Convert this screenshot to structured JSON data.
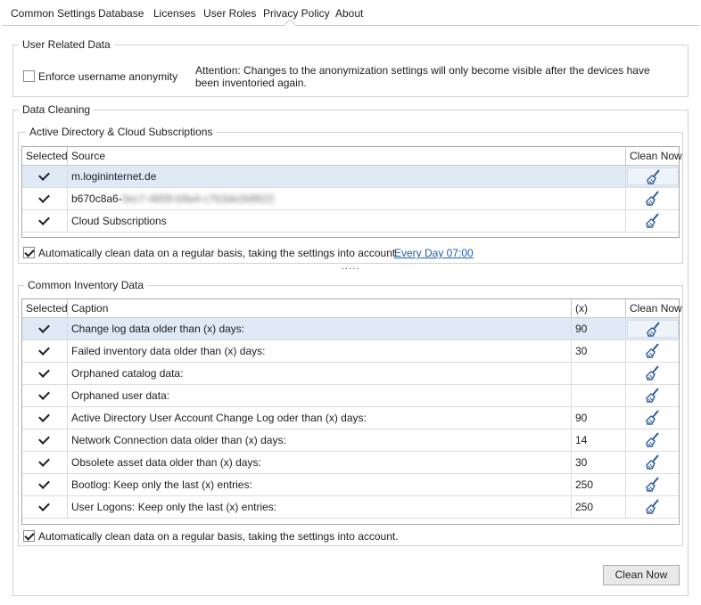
{
  "tabs": [
    {
      "label": "Common Settings"
    },
    {
      "label": "Database"
    },
    {
      "label": "Licenses"
    },
    {
      "label": "User Roles"
    },
    {
      "label": "Privacy Policy",
      "active": true
    },
    {
      "label": "About"
    }
  ],
  "user_related": {
    "title": "User Related Data",
    "enforce_label": "Enforce username anonymity",
    "enforce_checked": false,
    "attention": "Attention: Changes to the anonymization settings will only become visible after the devices have been inventoried again."
  },
  "data_cleaning": {
    "title": "Data Cleaning",
    "ad": {
      "title": "Active Directory & Cloud Subscriptions",
      "columns": [
        "Selected",
        "Source",
        "Clean Now"
      ],
      "rows": [
        {
          "selected": true,
          "source": "m.logininternet.de",
          "blurred_suffix": ""
        },
        {
          "selected": true,
          "source": "b670c8a6-",
          "blurred_suffix": "0ec7-4659-b9a4-c7b3de2b8622"
        },
        {
          "selected": true,
          "source": "Cloud Subscriptions",
          "blurred_suffix": ""
        }
      ],
      "auto_clean_label": "Automatically clean data on a regular basis, taking the settings into account.",
      "auto_clean_checked": true,
      "schedule_link": "Every Day  07:00"
    },
    "splitter": ".....",
    "inventory": {
      "title": "Common Inventory Data",
      "columns": [
        "Selected",
        "Caption",
        "(x)",
        "Clean Now"
      ],
      "rows": [
        {
          "selected": true,
          "caption": "Change log data older than (x) days:",
          "x": "90"
        },
        {
          "selected": true,
          "caption": "Failed inventory data older than (x) days:",
          "x": "30"
        },
        {
          "selected": true,
          "caption": "Orphaned catalog data:",
          "x": ""
        },
        {
          "selected": true,
          "caption": "Orphaned user data:",
          "x": ""
        },
        {
          "selected": true,
          "caption": "Active Directory User Account Change Log oder than (x) days:",
          "x": "90"
        },
        {
          "selected": true,
          "caption": "Network Connection data older than (x) days:",
          "x": "14"
        },
        {
          "selected": true,
          "caption": "Obsolete asset data older than (x) days:",
          "x": "30"
        },
        {
          "selected": true,
          "caption": "Bootlog: Keep only the last (x) entries:",
          "x": "250"
        },
        {
          "selected": true,
          "caption": "User Logons: Keep only the last (x) entries:",
          "x": "250"
        }
      ],
      "auto_clean_label": "Automatically clean data on a regular basis, taking the settings into account.",
      "auto_clean_checked": true
    },
    "clean_now_button": "Clean Now"
  },
  "icons": {
    "clean": "broom-icon"
  },
  "colors": {
    "selected_row": "#dfeaf6",
    "link": "#1a5fb4"
  }
}
